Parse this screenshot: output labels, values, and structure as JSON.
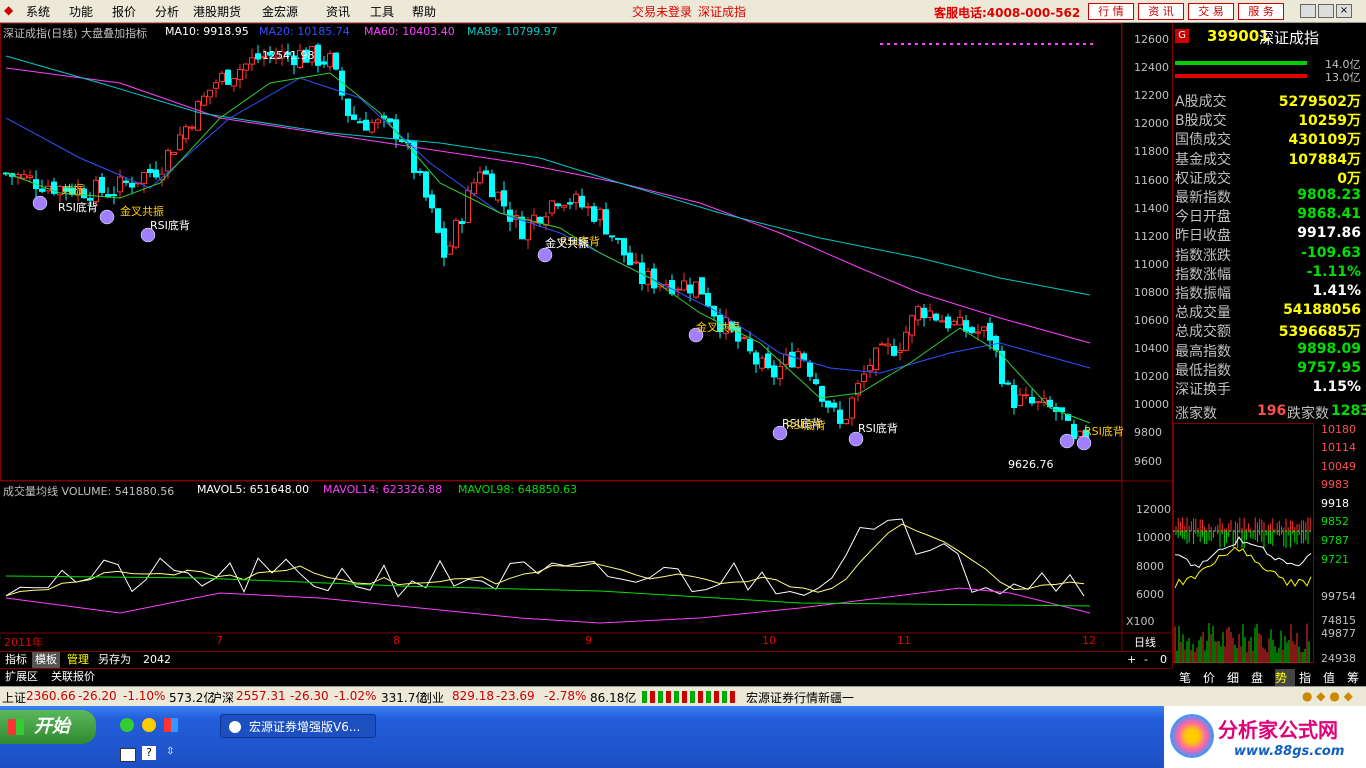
{
  "menu": {
    "items": [
      "系统",
      "功能",
      "报价",
      "分析",
      "港股期货",
      "金宏源",
      "资讯",
      "工具",
      "帮助"
    ],
    "status_text": "交易未登录",
    "index_title": "深证成指",
    "hotline": "客服电话:4008-000-562",
    "buttons": [
      "行 情",
      "资 讯",
      "交 易",
      "服 务"
    ]
  },
  "chart": {
    "title": "深证成指(日线) 大盘叠加指标",
    "ma10": "MA10: 9918.95",
    "ma20": "MA20: 10185.74",
    "ma60": "MA60: 10403.40",
    "ma89": "MA89: 10799.97",
    "high_mark": "12541.98",
    "low_mark": "9626.76",
    "price_ticks": [
      "12600",
      "12400",
      "12200",
      "12000",
      "11800",
      "11600",
      "11400",
      "11200",
      "11000",
      "10800",
      "10600",
      "10400",
      "10200",
      "10000",
      "9800",
      "9600"
    ],
    "signals": [
      "共振",
      "RSI底背",
      "金叉共振",
      "RSI底背",
      "RSI底背",
      "金叉共振",
      "金叉共振",
      "RSI底背",
      "RSI底背",
      "RSI底背",
      "RSI底背"
    ],
    "volume_title": "成交量均线 VOLUME: 541880.56",
    "mavol5": "MAVOL5: 651648.00",
    "mavol14": "MAVOL14: 623326.88",
    "mavol98": "MAVOL98: 648850.63",
    "volume_ticks": [
      "12000",
      "10000",
      "8000",
      "6000"
    ],
    "volume_unit": "X100",
    "date_labels": [
      "2011年",
      "7",
      "8",
      "9",
      "10",
      "11",
      "12"
    ],
    "period": "日线",
    "tools": [
      "+",
      "-",
      "0"
    ]
  },
  "tabs": {
    "row1": [
      "指标",
      "模板",
      "管理",
      "另存为",
      "2042"
    ],
    "row2": [
      "扩展区",
      "关联报价"
    ]
  },
  "quote": {
    "code": "399001",
    "name": "深证成指",
    "bar1_value": "14.0亿",
    "bar2_value": "13.0亿",
    "rows": [
      {
        "k": "A股成交",
        "v": "5279502万",
        "c": "yl"
      },
      {
        "k": "B股成交",
        "v": "10259万",
        "c": "yl"
      },
      {
        "k": "国债成交",
        "v": "430109万",
        "c": "yl"
      },
      {
        "k": "基金成交",
        "v": "107884万",
        "c": "yl"
      },
      {
        "k": "权证成交",
        "v": "0万",
        "c": "yl"
      },
      {
        "k": "最新指数",
        "v": "9808.23",
        "c": "dn"
      },
      {
        "k": "今日开盘",
        "v": "9868.41",
        "c": "dn"
      },
      {
        "k": "昨日收盘",
        "v": "9917.86",
        "c": "wh"
      },
      {
        "k": "指数涨跌",
        "v": "-109.63",
        "c": "dn"
      },
      {
        "k": "指数涨幅",
        "v": "-1.11%",
        "c": "dn"
      },
      {
        "k": "指数振幅",
        "v": "1.41%",
        "c": "wh"
      },
      {
        "k": "总成交量",
        "v": "54188056",
        "c": "yl"
      },
      {
        "k": "总成交额",
        "v": "5396685万",
        "c": "yl"
      },
      {
        "k": "最高指数",
        "v": "9898.09",
        "c": "dn"
      },
      {
        "k": "最低指数",
        "v": "9757.95",
        "c": "dn"
      },
      {
        "k": "深证换手",
        "v": "1.15%",
        "c": "wh"
      }
    ],
    "rise_label": "涨家数",
    "rise_count": "196",
    "fall_label": "跌家数",
    "fall_count": "1283",
    "mini_ticks_left": [
      "10180",
      "10114",
      "10049",
      "9983",
      "9918",
      "9852",
      "9787",
      "9721",
      "99754",
      "74815",
      "49877",
      "24938"
    ],
    "bottom_tabs": [
      "笔",
      "价",
      "细",
      "盘",
      "势",
      "指",
      "值",
      "筹"
    ]
  },
  "statusbar": {
    "sh_name": "上证",
    "sh_val": "2360.66",
    "sh_chg": "-26.20",
    "sh_pct": "-1.10%",
    "sh_amt": "573.2亿",
    "hs_name": "沪深",
    "hs_val": "2557.31",
    "hs_chg": "-26.30",
    "hs_pct": "-1.02%",
    "hs_amt": "331.7亿",
    "cy_name": "创业",
    "cy_val": "829.18",
    "cy_chg": "-23.69",
    "cy_pct": "-2.78%",
    "cy_amt": "86.18亿",
    "ticker": "宏源证券行情新疆一"
  },
  "taskbar": {
    "start": "开始",
    "task": "宏源证券增强版V6...",
    "logo_main": "分析家公式网",
    "logo_sub": "www.88gs.com"
  }
}
